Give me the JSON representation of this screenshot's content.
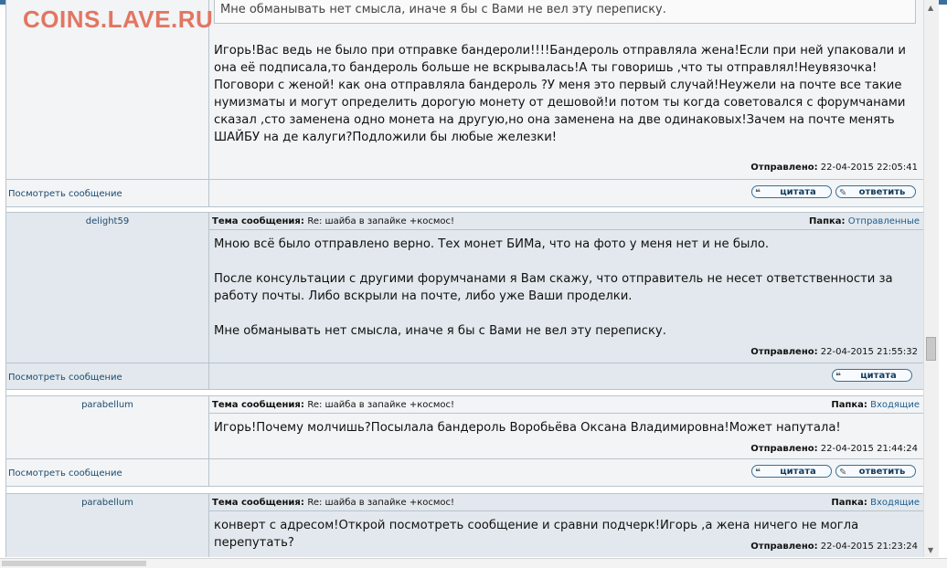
{
  "watermark": "COINS.LAVE.RU",
  "common": {
    "view_link": "Посмотреть сообщение",
    "subject_label": "Тема сообщения:",
    "folder_label": "Папка:",
    "sent_label": "Отправлено:",
    "quote_btn": "цитата",
    "reply_btn": "ответить"
  },
  "posts": [
    {
      "quote_text": "Мне обманывать нет смысла, иначе я бы с Вами не вел эту переписку.",
      "text": "Игорь!Вас ведь не было при отправке бандероли!!!!Бандероль отправляла жена!Если при ней упаковали и она её подписала,то бандероль больше не вскрывалась!А ты говоришь ,что ты отправлял!Неувязочка!Поговори с женой! как она отправляла бандероль ?У меня это первый случай!Неужели на почте все такие нумизматы и могут определить дорогую монету от дешовой!и потом ты когда советовался с форумчанами сказал ,сто заменена одно монета на другую,но она заменена на две одинаковых!Зачем на почте менять ШАЙБУ на де калуги?Подложили бы любые железки!",
      "sent": "22-04-2015 22:05:41"
    },
    {
      "author": "delight59",
      "subject": "Re: шайба в запайке +космос!",
      "folder": "Отправленные",
      "text": "Мною всё было отправлено верно. Тех монет БИМа, что на фото у меня нет и не было.\n\nПосле консультации с другими форумчанами я Вам скажу, что отправитель не несет ответственности за работу почты. Либо вскрыли на почте, либо уже Ваши проделки.\n\nМне обманывать нет смысла, иначе я бы с Вами не вел эту переписку.",
      "sent": "22-04-2015 21:55:32"
    },
    {
      "author": "parabellum",
      "subject": "Re: шайба в запайке +космос!",
      "folder": "Входящие",
      "text": "Игорь!Почему молчишь?Посылала бандероль Воробьёва Оксана Владимировна!Может напутала!",
      "sent": "22-04-2015 21:44:24"
    },
    {
      "author": "parabellum",
      "subject": "Re: шайба в запайке +космос!",
      "folder": "Входящие",
      "text": "конверт с адресом!Открой посмотреть сообщение и сравни подчерк!Игорь ,а жена ничего не могла перепутать?",
      "sent": "22-04-2015 21:23:24"
    }
  ]
}
